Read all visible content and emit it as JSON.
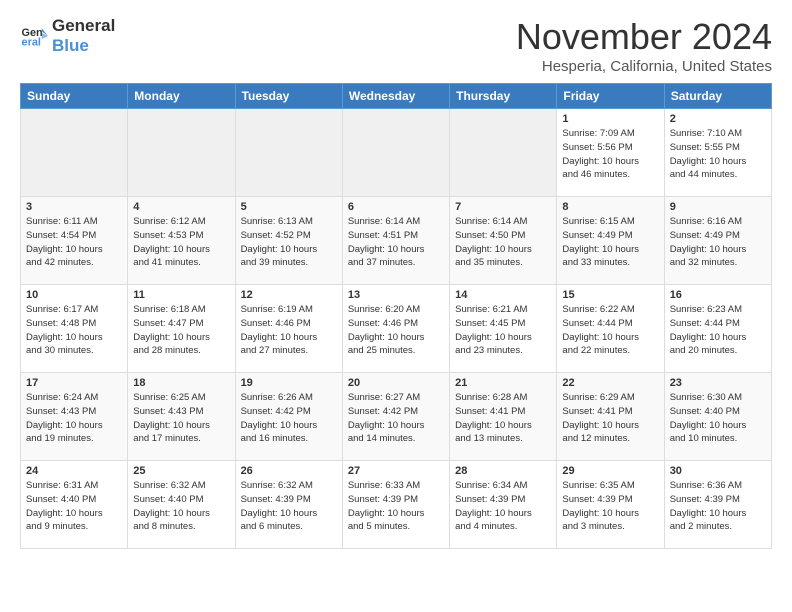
{
  "logo": {
    "line1": "General",
    "line2": "Blue"
  },
  "title": "November 2024",
  "location": "Hesperia, California, United States",
  "weekdays": [
    "Sunday",
    "Monday",
    "Tuesday",
    "Wednesday",
    "Thursday",
    "Friday",
    "Saturday"
  ],
  "weeks": [
    [
      {
        "day": "",
        "info": ""
      },
      {
        "day": "",
        "info": ""
      },
      {
        "day": "",
        "info": ""
      },
      {
        "day": "",
        "info": ""
      },
      {
        "day": "",
        "info": ""
      },
      {
        "day": "1",
        "info": "Sunrise: 7:09 AM\nSunset: 5:56 PM\nDaylight: 10 hours\nand 46 minutes."
      },
      {
        "day": "2",
        "info": "Sunrise: 7:10 AM\nSunset: 5:55 PM\nDaylight: 10 hours\nand 44 minutes."
      }
    ],
    [
      {
        "day": "3",
        "info": "Sunrise: 6:11 AM\nSunset: 4:54 PM\nDaylight: 10 hours\nand 42 minutes."
      },
      {
        "day": "4",
        "info": "Sunrise: 6:12 AM\nSunset: 4:53 PM\nDaylight: 10 hours\nand 41 minutes."
      },
      {
        "day": "5",
        "info": "Sunrise: 6:13 AM\nSunset: 4:52 PM\nDaylight: 10 hours\nand 39 minutes."
      },
      {
        "day": "6",
        "info": "Sunrise: 6:14 AM\nSunset: 4:51 PM\nDaylight: 10 hours\nand 37 minutes."
      },
      {
        "day": "7",
        "info": "Sunrise: 6:14 AM\nSunset: 4:50 PM\nDaylight: 10 hours\nand 35 minutes."
      },
      {
        "day": "8",
        "info": "Sunrise: 6:15 AM\nSunset: 4:49 PM\nDaylight: 10 hours\nand 33 minutes."
      },
      {
        "day": "9",
        "info": "Sunrise: 6:16 AM\nSunset: 4:49 PM\nDaylight: 10 hours\nand 32 minutes."
      }
    ],
    [
      {
        "day": "10",
        "info": "Sunrise: 6:17 AM\nSunset: 4:48 PM\nDaylight: 10 hours\nand 30 minutes."
      },
      {
        "day": "11",
        "info": "Sunrise: 6:18 AM\nSunset: 4:47 PM\nDaylight: 10 hours\nand 28 minutes."
      },
      {
        "day": "12",
        "info": "Sunrise: 6:19 AM\nSunset: 4:46 PM\nDaylight: 10 hours\nand 27 minutes."
      },
      {
        "day": "13",
        "info": "Sunrise: 6:20 AM\nSunset: 4:46 PM\nDaylight: 10 hours\nand 25 minutes."
      },
      {
        "day": "14",
        "info": "Sunrise: 6:21 AM\nSunset: 4:45 PM\nDaylight: 10 hours\nand 23 minutes."
      },
      {
        "day": "15",
        "info": "Sunrise: 6:22 AM\nSunset: 4:44 PM\nDaylight: 10 hours\nand 22 minutes."
      },
      {
        "day": "16",
        "info": "Sunrise: 6:23 AM\nSunset: 4:44 PM\nDaylight: 10 hours\nand 20 minutes."
      }
    ],
    [
      {
        "day": "17",
        "info": "Sunrise: 6:24 AM\nSunset: 4:43 PM\nDaylight: 10 hours\nand 19 minutes."
      },
      {
        "day": "18",
        "info": "Sunrise: 6:25 AM\nSunset: 4:43 PM\nDaylight: 10 hours\nand 17 minutes."
      },
      {
        "day": "19",
        "info": "Sunrise: 6:26 AM\nSunset: 4:42 PM\nDaylight: 10 hours\nand 16 minutes."
      },
      {
        "day": "20",
        "info": "Sunrise: 6:27 AM\nSunset: 4:42 PM\nDaylight: 10 hours\nand 14 minutes."
      },
      {
        "day": "21",
        "info": "Sunrise: 6:28 AM\nSunset: 4:41 PM\nDaylight: 10 hours\nand 13 minutes."
      },
      {
        "day": "22",
        "info": "Sunrise: 6:29 AM\nSunset: 4:41 PM\nDaylight: 10 hours\nand 12 minutes."
      },
      {
        "day": "23",
        "info": "Sunrise: 6:30 AM\nSunset: 4:40 PM\nDaylight: 10 hours\nand 10 minutes."
      }
    ],
    [
      {
        "day": "24",
        "info": "Sunrise: 6:31 AM\nSunset: 4:40 PM\nDaylight: 10 hours\nand 9 minutes."
      },
      {
        "day": "25",
        "info": "Sunrise: 6:32 AM\nSunset: 4:40 PM\nDaylight: 10 hours\nand 8 minutes."
      },
      {
        "day": "26",
        "info": "Sunrise: 6:32 AM\nSunset: 4:39 PM\nDaylight: 10 hours\nand 6 minutes."
      },
      {
        "day": "27",
        "info": "Sunrise: 6:33 AM\nSunset: 4:39 PM\nDaylight: 10 hours\nand 5 minutes."
      },
      {
        "day": "28",
        "info": "Sunrise: 6:34 AM\nSunset: 4:39 PM\nDaylight: 10 hours\nand 4 minutes."
      },
      {
        "day": "29",
        "info": "Sunrise: 6:35 AM\nSunset: 4:39 PM\nDaylight: 10 hours\nand 3 minutes."
      },
      {
        "day": "30",
        "info": "Sunrise: 6:36 AM\nSunset: 4:39 PM\nDaylight: 10 hours\nand 2 minutes."
      }
    ]
  ]
}
